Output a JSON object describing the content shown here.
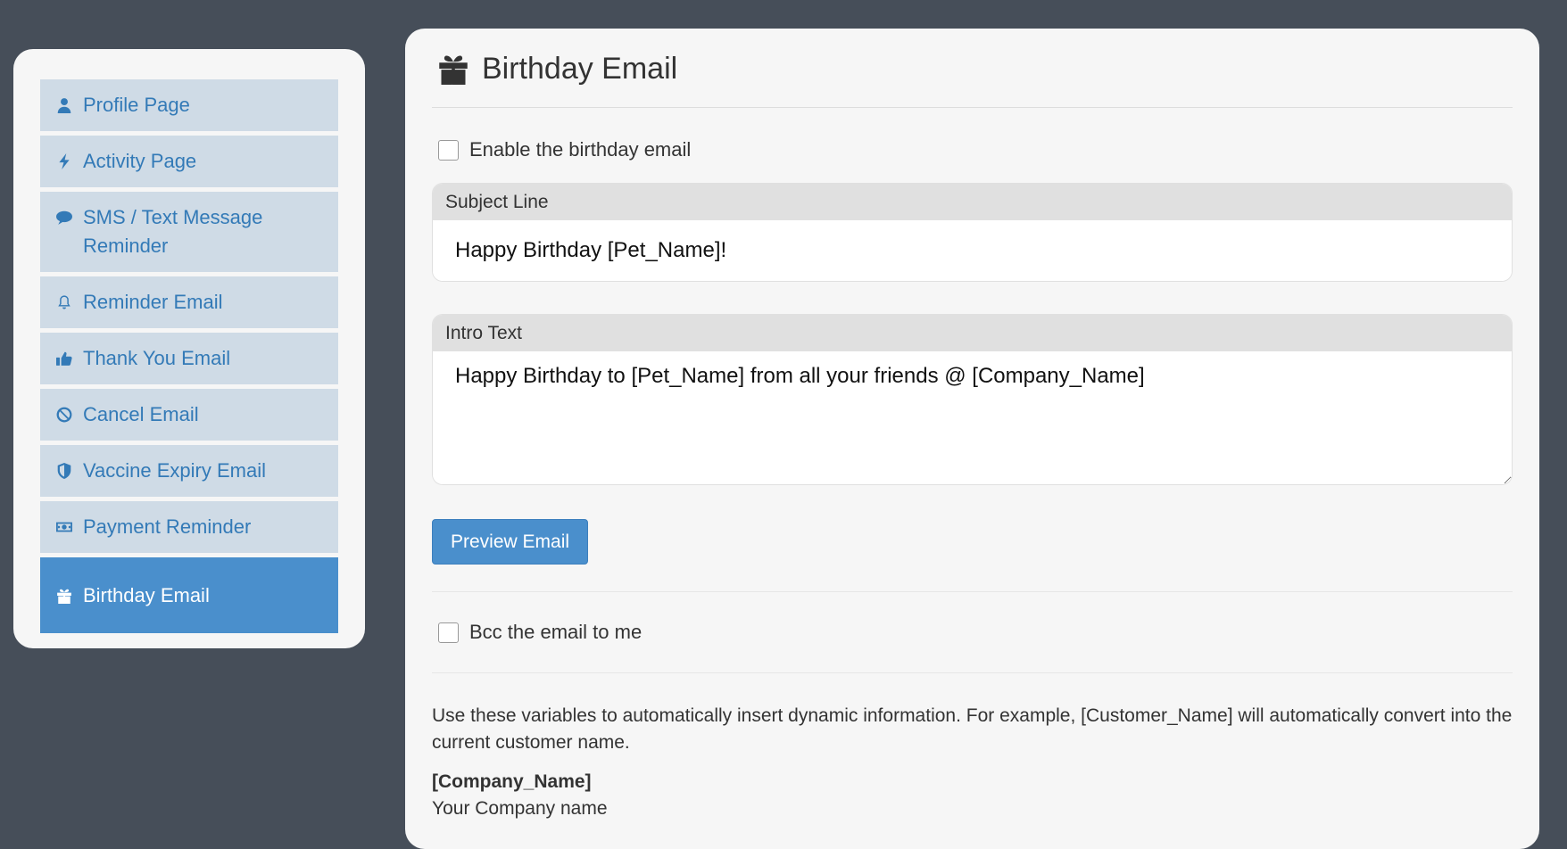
{
  "sidebar": {
    "items": [
      {
        "label": "Profile Page",
        "icon": "user-icon"
      },
      {
        "label": "Activity Page",
        "icon": "bolt-icon"
      },
      {
        "label": "SMS / Text Message Reminder",
        "icon": "comment-icon"
      },
      {
        "label": "Reminder Email",
        "icon": "bell-icon"
      },
      {
        "label": "Thank You Email",
        "icon": "thumbs-up-icon"
      },
      {
        "label": "Cancel Email",
        "icon": "ban-icon"
      },
      {
        "label": "Vaccine Expiry Email",
        "icon": "shield-icon"
      },
      {
        "label": "Payment Reminder",
        "icon": "money-icon"
      },
      {
        "label": "Birthday Email",
        "icon": "gift-icon",
        "active": true
      }
    ],
    "colors": {
      "item_bg": "#cfdbe6",
      "item_text": "#337ab7",
      "active_bg": "#4a8fcc"
    }
  },
  "main": {
    "title": "Birthday Email",
    "title_icon": "gift-icon",
    "enable_label": "Enable the birthday email",
    "enable_checked": false,
    "subject": {
      "label": "Subject Line",
      "value": "Happy Birthday [Pet_Name]!"
    },
    "intro": {
      "label": "Intro Text",
      "value": "Happy Birthday to [Pet_Name] from all your friends @ [Company_Name]"
    },
    "preview_button": "Preview Email",
    "bcc_label": "Bcc the email to me",
    "bcc_checked": false,
    "help_text": "Use these variables to automatically insert dynamic information. For example, [Customer_Name] will automatically convert into the current customer name.",
    "variables": [
      {
        "name": "[Company_Name]",
        "description": "Your Company name"
      }
    ]
  }
}
